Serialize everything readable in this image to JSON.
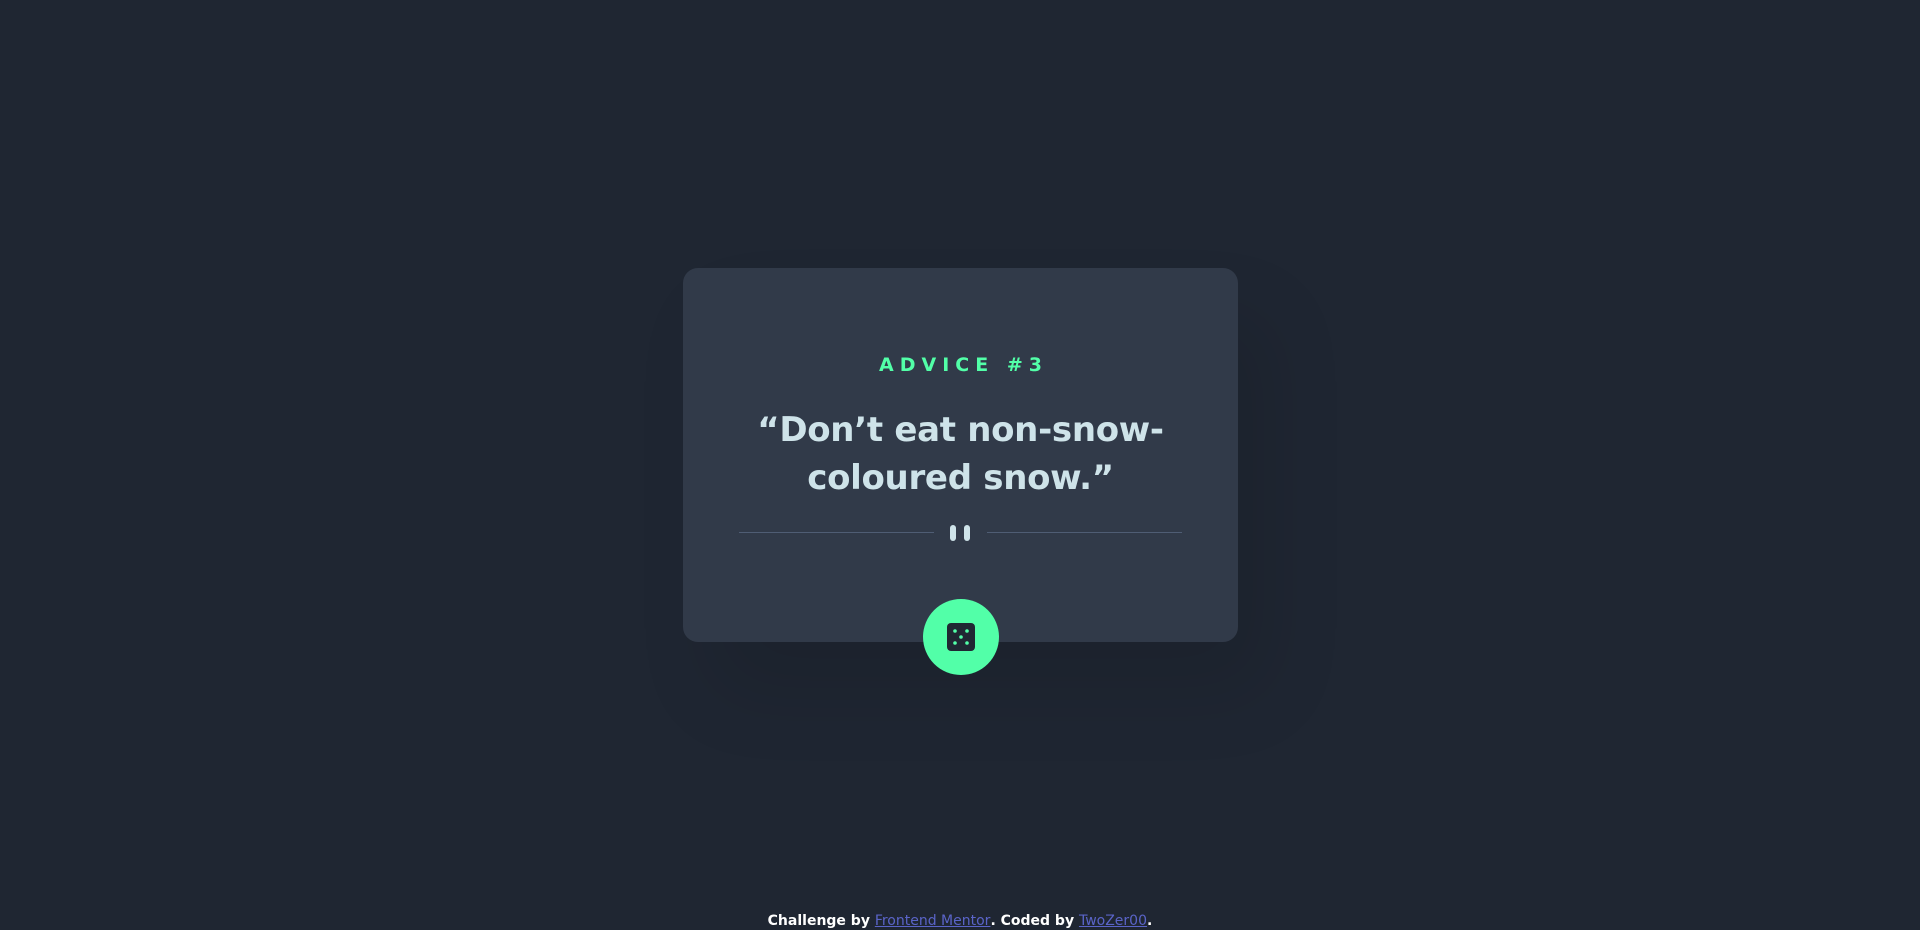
{
  "advice": {
    "id_label": "ADVICE #3",
    "quote": "“Don’t eat non-snow-coloured snow.”"
  },
  "dice_button": {
    "icon": "dice-icon"
  },
  "divider": {
    "icon": "pause-icon"
  },
  "footer": {
    "challenge_prefix": "Challenge by ",
    "challenge_link": "Frontend Mentor",
    "coded_prefix": ". Coded by ",
    "coded_link": "TwoZer00",
    "suffix": "."
  },
  "colors": {
    "background": "#1f2632",
    "card": "#313a49",
    "accent": "#52ffa8",
    "text": "#cee3e9",
    "link": "#5a64c8"
  }
}
